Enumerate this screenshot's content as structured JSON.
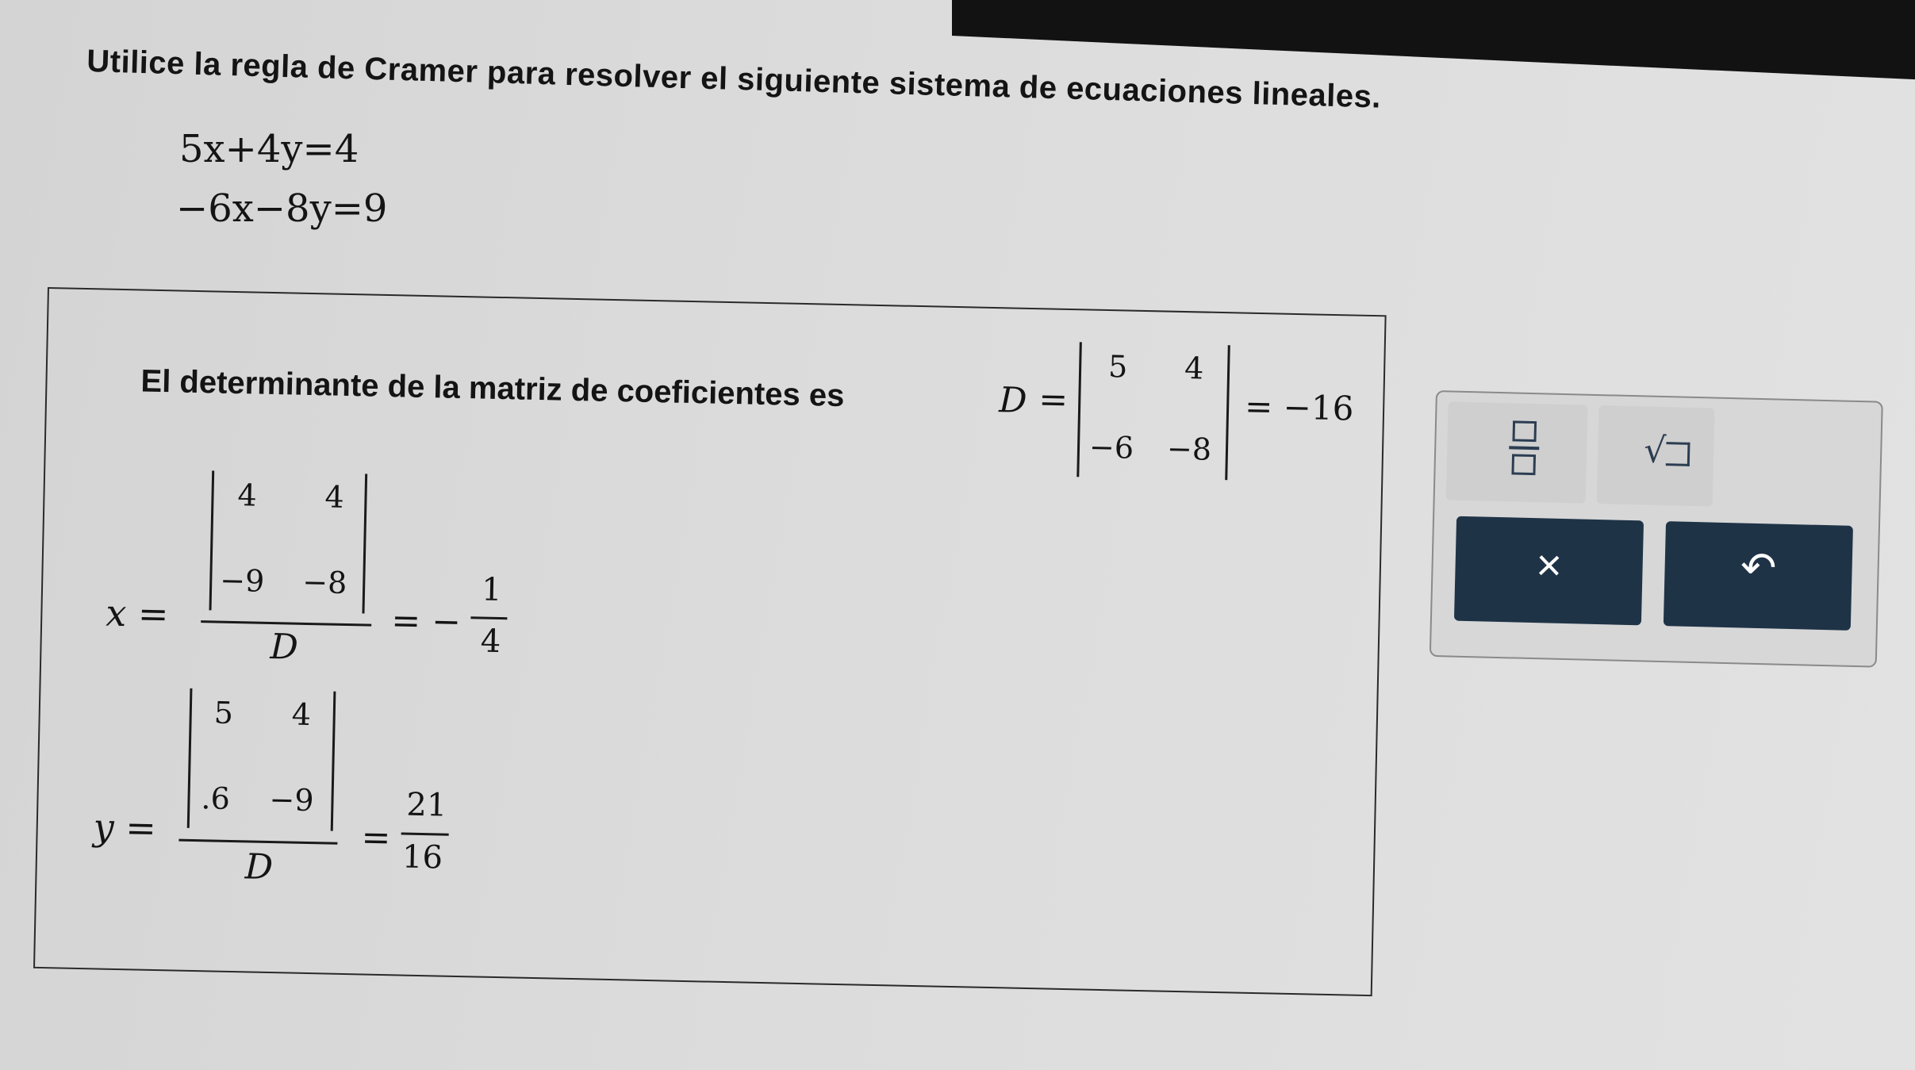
{
  "instruction": "Utilice la regla de Cramer para resolver el siguiente sistema de ecuaciones lineales.",
  "equations": {
    "eq1": "5x+4y=4",
    "eq2": "−6x−8y=9"
  },
  "answer": {
    "determinant_text": "El determinante de la matriz de coeficientes es",
    "D_symbol": "D",
    "equals": "=",
    "D_matrix": {
      "a": "5",
      "b": "4",
      "c": "−6",
      "d": "−8"
    },
    "D_value": "= −16",
    "x_label": "x =",
    "x_matrix": {
      "a": "4",
      "b": "4",
      "c": "−9",
      "d": "−8"
    },
    "x_denominator": "D",
    "x_sign": "= −",
    "x_num": "1",
    "x_den": "4",
    "y_label": "y =",
    "y_matrix": {
      "a": "5",
      "b": "4",
      "c": ".6",
      "d": "−9"
    },
    "y_denominator": "D",
    "y_sign": "=",
    "y_num": "21",
    "y_den": "16"
  },
  "toolbar": {
    "clear_label": "×",
    "undo_label": "↶",
    "fraction_icon": "fraction-template-icon",
    "sqrt_icon": "square-root-template-icon",
    "sqrt_symbol": "√",
    "accent": "#1f3347"
  }
}
